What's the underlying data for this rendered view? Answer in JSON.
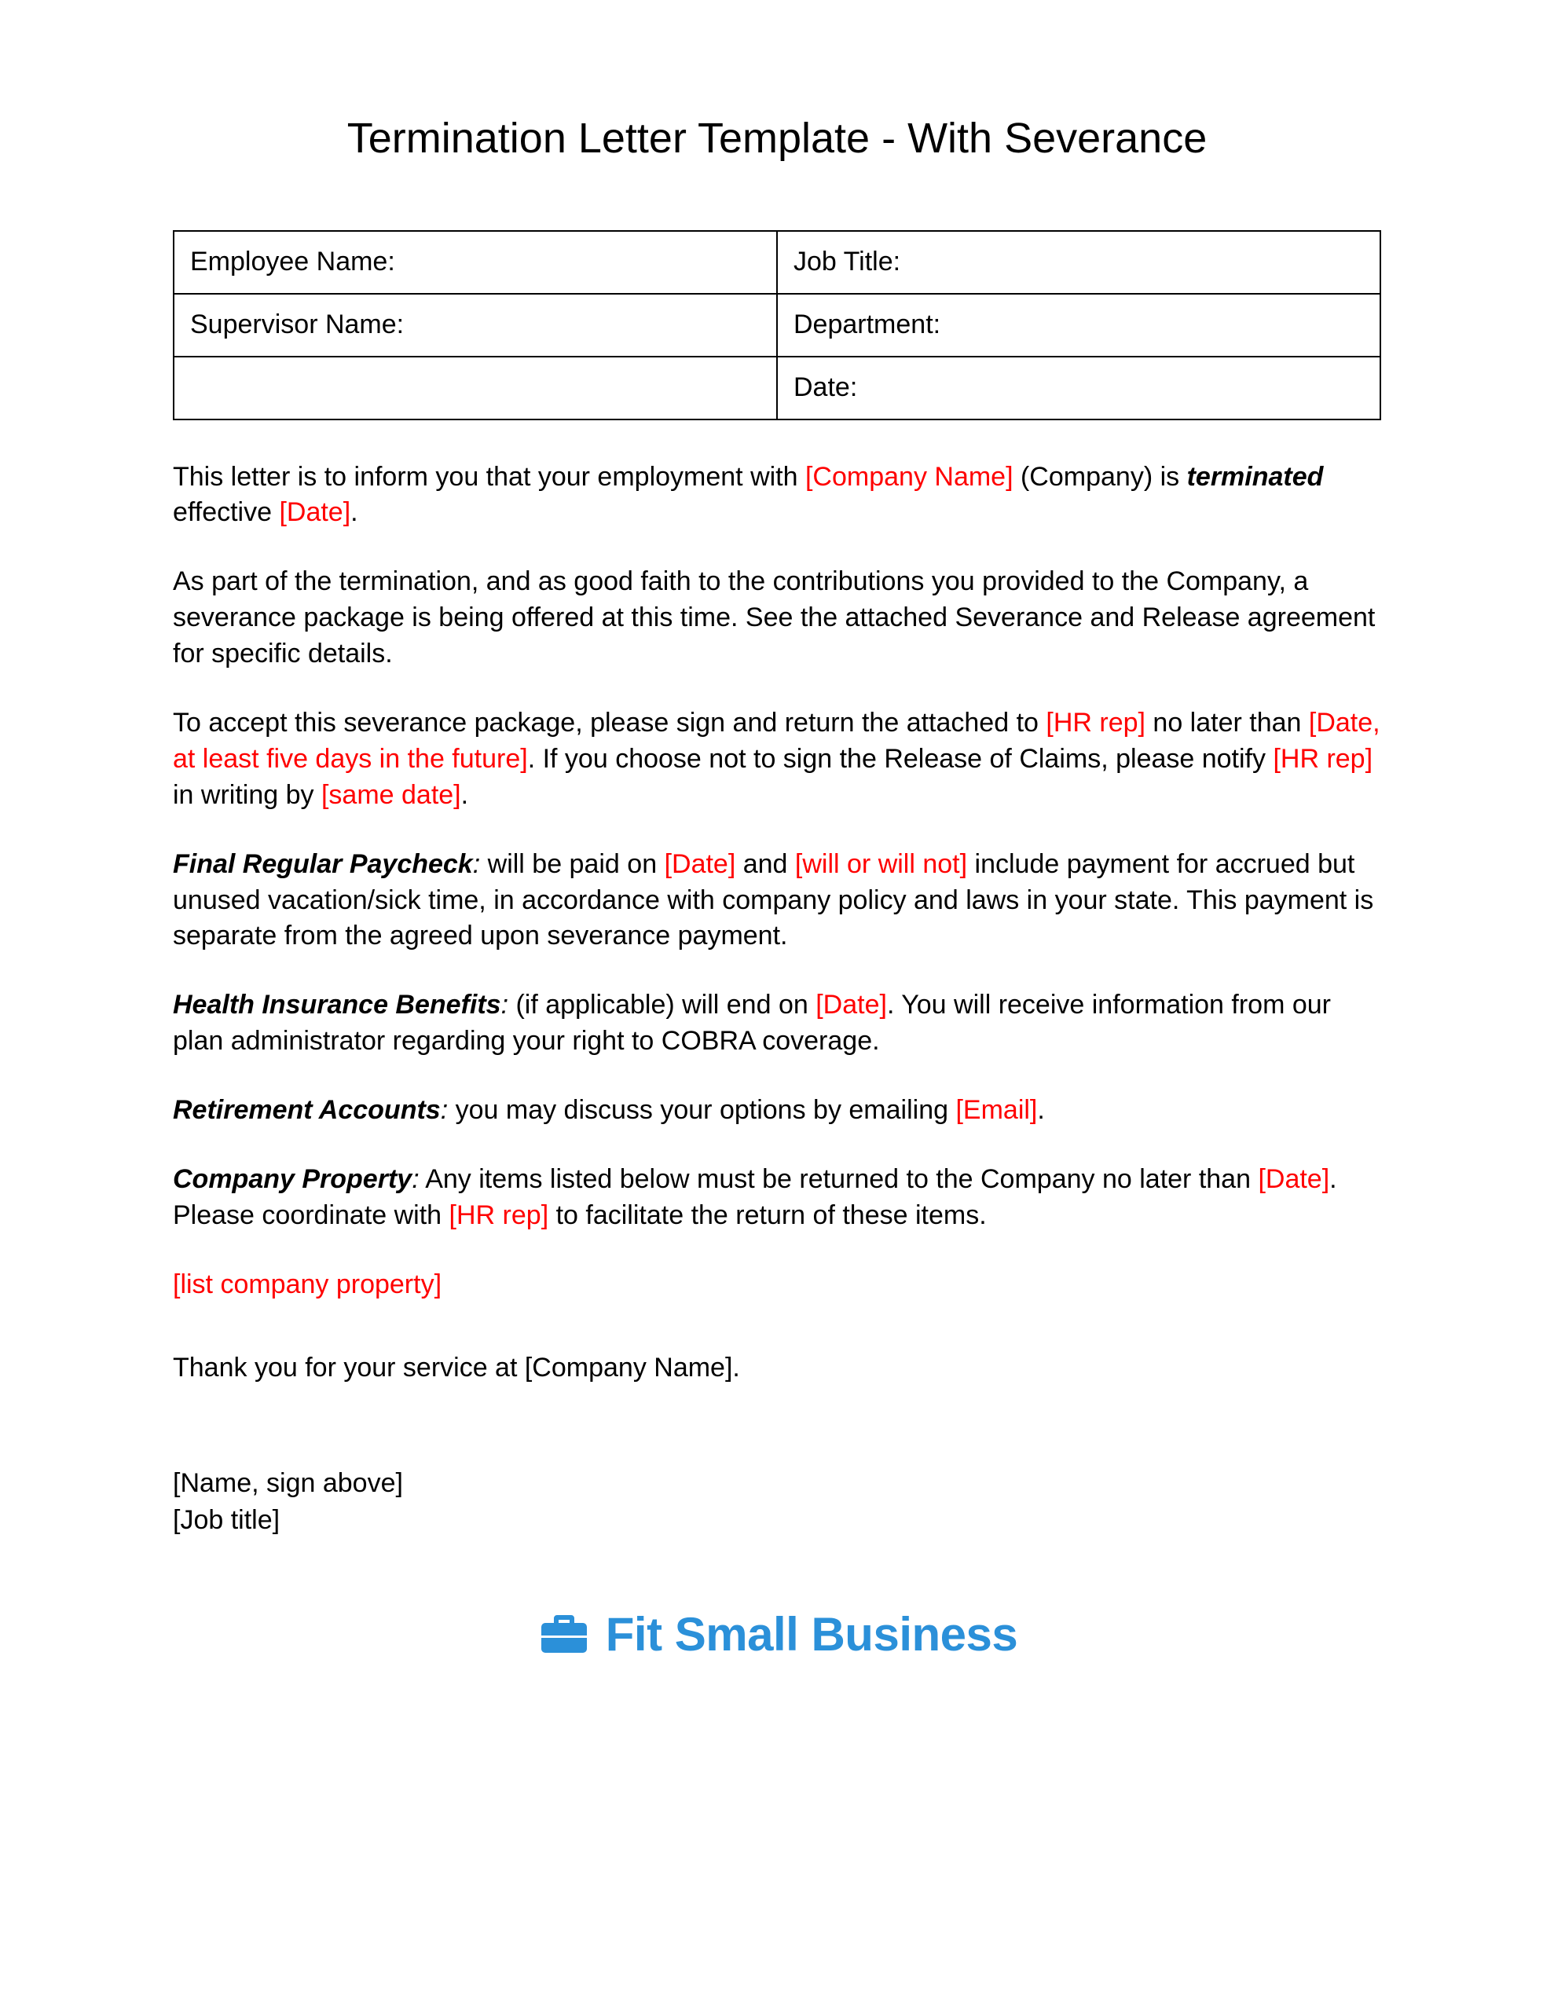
{
  "title": "Termination Letter Template - With Severance",
  "table": {
    "r1c1": "Employee Name:",
    "r1c2": "Job Title:",
    "r2c1": "Supervisor Name:",
    "r2c2": "Department:",
    "r3c1": "",
    "r3c2": "Date:"
  },
  "p1": {
    "t1": "This letter is to inform you that your employment with ",
    "ph1": "[Company Name]",
    "t2": " (Company) is ",
    "b1": "terminated",
    "t3": " effective ",
    "ph2": "[Date]",
    "t4": "."
  },
  "p2": "As part of the termination, and as good faith to the contributions you provided to the Company, a severance package is being offered at this time. See the attached Severance and Release agreement for specific details.",
  "p3": {
    "t1": "To accept this severance package, please sign and return the attached to ",
    "ph1": "[HR rep]",
    "t2": " no later than ",
    "ph2": "[Date, at least five days in the future]",
    "t3": ". If you choose not to sign the Release of Claims, please notify ",
    "ph3": "[HR rep]",
    "t4": " in writing by ",
    "ph4": "[same date]",
    "t5": "."
  },
  "p4": {
    "b1": "Final Regular Paycheck",
    "i1": ":",
    "t1": " will be paid on ",
    "ph1": "[Date]",
    "t2": " and ",
    "ph2": "[will or will not]",
    "t3": " include payment for accrued but unused vacation/sick time, in accordance with company policy and laws in your state. This payment is separate from the agreed upon severance payment."
  },
  "p5": {
    "b1": "Health Insurance Benefits",
    "i1": ":",
    "t1": " (if applicable) will end on ",
    "ph1": "[Date]",
    "t2": ". You will receive information from our plan administrator regarding your right to COBRA coverage."
  },
  "p6": {
    "b1": "Retirement Accounts",
    "i1": ":",
    "t1": " you may discuss your options by emailing ",
    "ph1": "[Email]",
    "t2": "."
  },
  "p7": {
    "b1": "Company Property",
    "i1": ":",
    "t1": " Any items listed below must be returned to the Company no later than ",
    "ph1": "[Date]",
    "t2": ". Please coordinate with ",
    "ph2": "[HR rep]",
    "t3": " to facilitate the return of these items."
  },
  "p8": "[list company property]",
  "p9": "Thank you for your service at [Company Name].",
  "sig": {
    "name": "[Name, sign above]",
    "title": "[Job title]"
  },
  "logo": "Fit Small Business"
}
